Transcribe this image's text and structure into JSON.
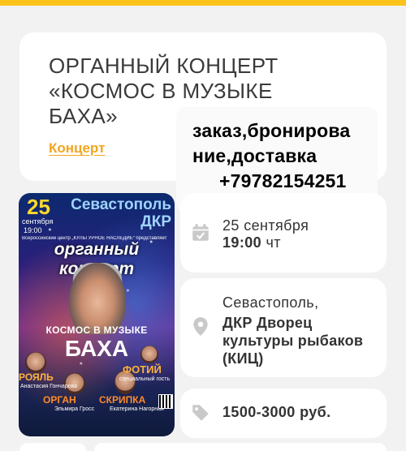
{
  "event": {
    "title": "ОРГАННЫЙ КОНЦЕРТ «КОСМОС В МУЗЫКЕ БАХА»",
    "category": "Концерт"
  },
  "overlay": {
    "line1": "заказ,бронирова",
    "line2": "ние,доставка",
    "phone": "+79782154251"
  },
  "poster": {
    "date": "25",
    "month": "сентября",
    "time": "19:00",
    "city": "Севастополь",
    "venue_short": "ДКР",
    "organizer": "Всероссийский центр „КУЛЬТУРНОЕ НАСЛЕДИЕ“ представляет",
    "headline": "органный концерт",
    "subtitle": "КОСМОС В МУЗЫКЕ",
    "subtitle2": "БАХА",
    "performer1_role": "РОЯЛЬ",
    "performer1_name": "Анастасия Гончарова",
    "performer2_name": "ФОТИЙ",
    "performer2_role": "специальный гость",
    "performer3_role": "ОРГАН",
    "performer3_name": "Эльмира Гросс",
    "performer4_role": "СКРИПКА",
    "performer4_name": "Екатерина Нагорная"
  },
  "date_info": {
    "day_month": "25 сентября",
    "time": "19:00",
    "weekday": "чт"
  },
  "place_info": {
    "city": "Севастополь,",
    "venue": "ДКР Дворец культуры рыбаков (КИЦ)"
  },
  "price_info": {
    "price": "1500-3000 руб."
  },
  "colors": {
    "accent": "#fdc31a",
    "link": "#f2a51e",
    "icon": "#c9c9c9",
    "background": "#f2f2f2"
  }
}
